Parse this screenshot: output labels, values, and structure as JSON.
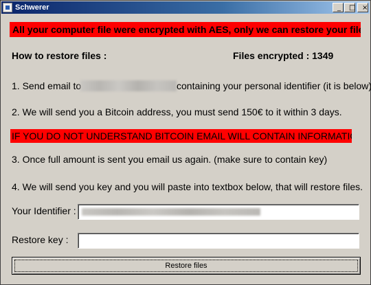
{
  "window": {
    "title": "Schwerer",
    "minimize_glyph": "_",
    "maximize_glyph": "□",
    "close_glyph": "×"
  },
  "banner_top": "All your computer file were encrypted with AES, only we can restore your files.",
  "how_to_restore": "How to restore files :",
  "files_encrypted": "Files encrypted : 1349",
  "step1_prefix": "1. Send email to",
  "step1_suffix": "containing your personal identifier (it is below)",
  "step2": "2. We will send you a Bitcoin address, you must send 150€ to it within 3 days.",
  "banner_warning": "IF YOU DO NOT UNDERSTAND BITCOIN EMAIL WILL CONTAIN INFORMATIONS",
  "step3": "3. Once full amount is sent you email us again. (make sure to contain key)",
  "step4": "4. We will send you key and you will paste into textbox below, that will restore files.",
  "identifier_label": "Your Identifier :",
  "identifier_value": "",
  "restore_key_label": "Restore key :",
  "restore_key_value": "",
  "restore_button": "Restore files"
}
